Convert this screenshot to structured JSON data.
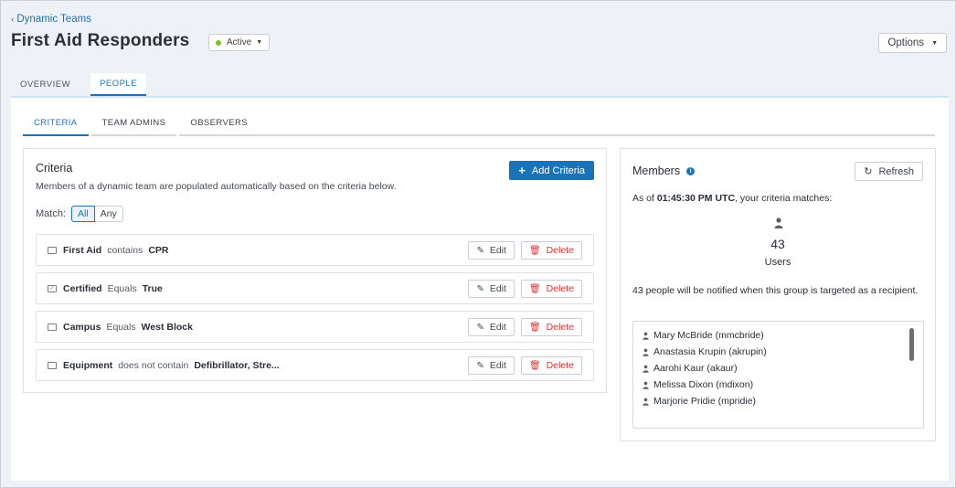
{
  "breadcrumb": {
    "label": "Dynamic Teams"
  },
  "header": {
    "title": "First Aid Responders",
    "status": "Active",
    "options_label": "Options"
  },
  "tabs": [
    {
      "label": "OVERVIEW"
    },
    {
      "label": "PEOPLE"
    }
  ],
  "subtabs": [
    {
      "label": "CRITERIA"
    },
    {
      "label": "TEAM ADMINS"
    },
    {
      "label": "OBSERVERS"
    }
  ],
  "criteria": {
    "title": "Criteria",
    "add_label": "Add Criteria",
    "description": "Members of a dynamic team are populated automatically based on the criteria below.",
    "match_label": "Match:",
    "match_options": [
      "All",
      "Any"
    ],
    "edit_label": "Edit",
    "delete_label": "Delete",
    "rows": [
      {
        "field": "First Aid",
        "operator": "contains",
        "value": "CPR"
      },
      {
        "field": "Certified",
        "operator": "Equals",
        "value": "True"
      },
      {
        "field": "Campus",
        "operator": "Equals",
        "value": "West Block"
      },
      {
        "field": "Equipment",
        "operator": "does not contain",
        "value": "Defibrillator, Stre..."
      }
    ]
  },
  "members": {
    "title": "Members",
    "refresh_label": "Refresh",
    "as_of_prefix": "As of",
    "time": "01:45:30 PM UTC",
    "as_of_suffix": ", your criteria matches:",
    "count": "43",
    "count_label": "Users",
    "notify_text": "43 people will be notified when this group is targeted as a recipient.",
    "people": [
      "Mary McBride (mmcbride)",
      "Anastasia Krupin (akrupin)",
      "Aarohi Kaur (akaur)",
      "Melissa Dixon (mdixon)",
      "Marjorie Pridie (mpridie)"
    ]
  },
  "colors": {
    "accent": "#1a73b8",
    "danger": "#dd3333",
    "active_status": "#7cc322"
  }
}
